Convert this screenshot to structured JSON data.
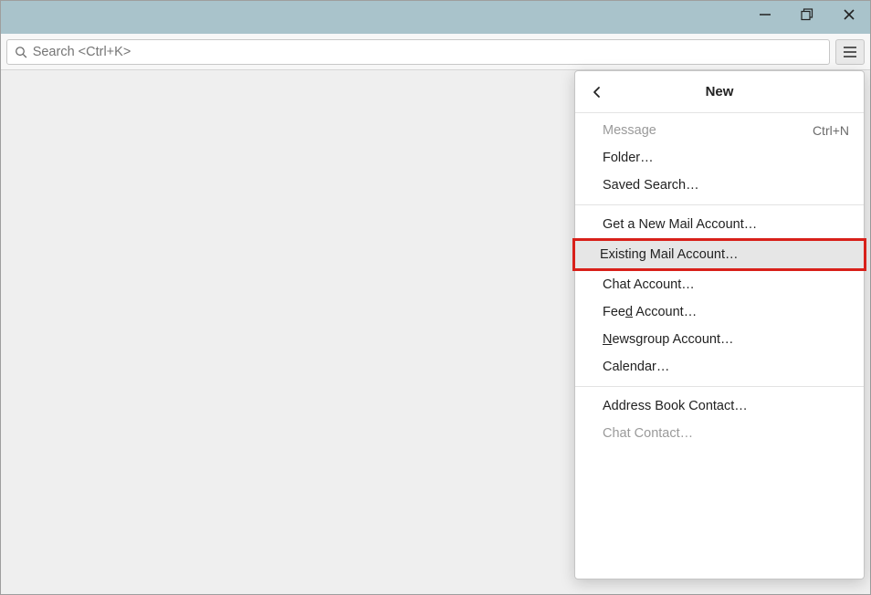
{
  "window": {
    "minimize_title": "Minimize",
    "maximize_title": "Restore Down",
    "close_title": "Close"
  },
  "toolbar": {
    "search_placeholder": "Search <Ctrl+K>",
    "menu_title": "Display the application menu"
  },
  "panel": {
    "title": "New",
    "back_title": "Back",
    "items": {
      "message": {
        "label": "Message",
        "shortcut": "Ctrl+N"
      },
      "folder": {
        "label": "Folder…"
      },
      "saved": {
        "label": "Saved Search…"
      },
      "newacct": {
        "label": "Get a New Mail Account…"
      },
      "existing": {
        "label": "Existing Mail Account…"
      },
      "chatacct": {
        "label": "Chat Account…"
      },
      "feed_pre": "Fee",
      "feed_ak": "d",
      "feed_post": " Account…",
      "news_pre": "",
      "news_ak": "N",
      "news_post": "ewsgroup Account…",
      "calendar": {
        "label": "Calendar…"
      },
      "abook": {
        "label": "Address Book Contact…"
      },
      "chatcontact": {
        "label": "Chat Contact…"
      }
    }
  }
}
